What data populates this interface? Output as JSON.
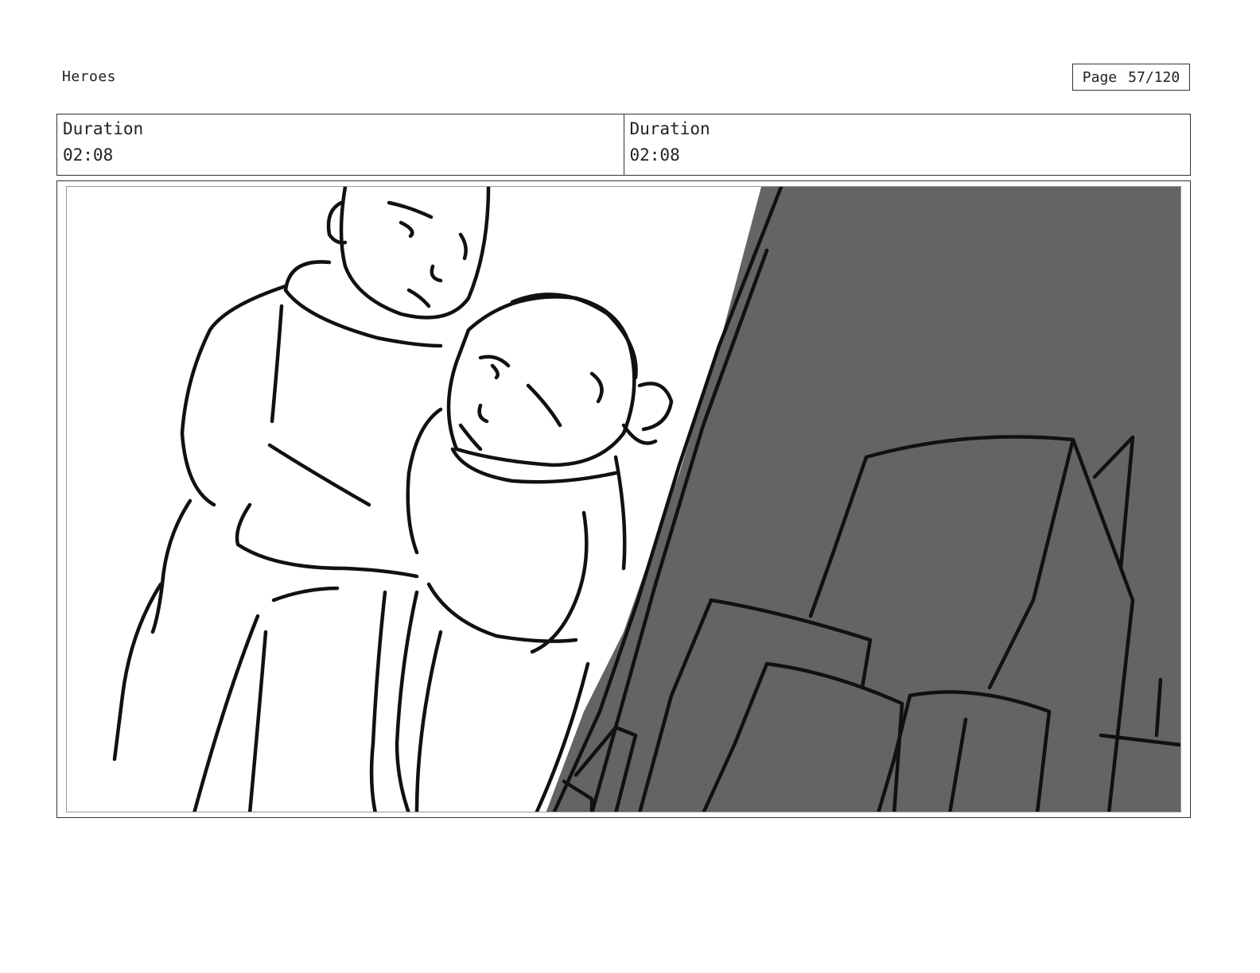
{
  "header": {
    "project_title": "Heroes",
    "page_label": "Page",
    "page_number": "57/120"
  },
  "shots": [
    {
      "label": "Duration",
      "value": "02:08"
    },
    {
      "label": "Duration",
      "value": "02:08"
    }
  ],
  "panel": {
    "style": "black ink sketch on white",
    "shadow_color": "#646464",
    "ink_color": "#111111"
  }
}
